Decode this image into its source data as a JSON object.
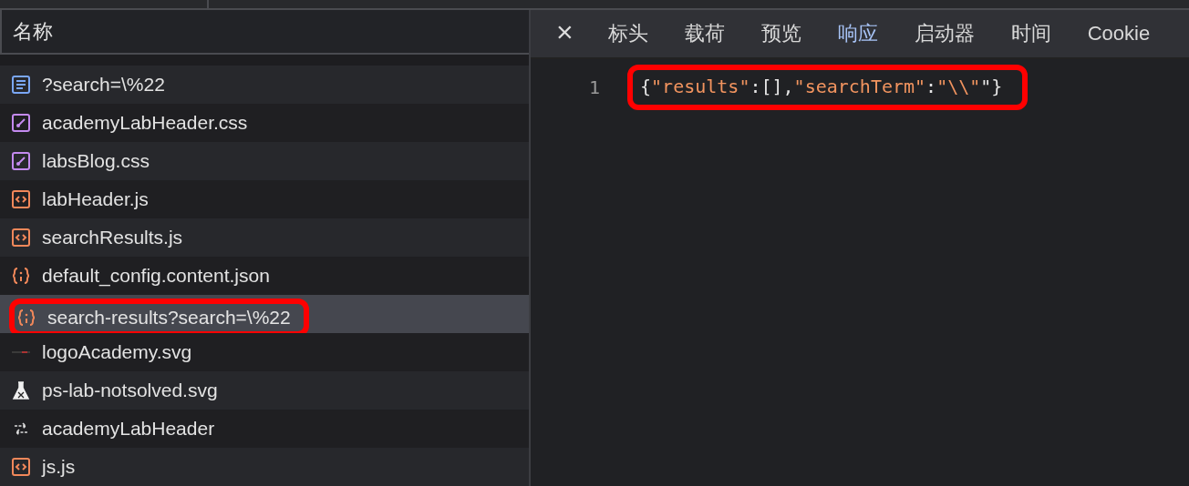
{
  "requests": {
    "column_header": "名称",
    "rows": [
      {
        "name": "?search=\\%22",
        "kind": "document",
        "selected": false,
        "highlighted": false
      },
      {
        "name": "academyLabHeader.css",
        "kind": "stylesheet",
        "selected": false,
        "highlighted": false
      },
      {
        "name": "labsBlog.css",
        "kind": "stylesheet",
        "selected": false,
        "highlighted": false
      },
      {
        "name": "labHeader.js",
        "kind": "script",
        "selected": false,
        "highlighted": false
      },
      {
        "name": "searchResults.js",
        "kind": "script",
        "selected": false,
        "highlighted": false
      },
      {
        "name": "default_config.content.json",
        "kind": "json",
        "selected": false,
        "highlighted": false
      },
      {
        "name": "search-results?search=\\%22",
        "kind": "json",
        "selected": true,
        "highlighted": true
      },
      {
        "name": "logoAcademy.svg",
        "kind": "image",
        "selected": false,
        "highlighted": false
      },
      {
        "name": "ps-lab-notsolved.svg",
        "kind": "flask",
        "selected": false,
        "highlighted": false
      },
      {
        "name": "academyLabHeader",
        "kind": "fetch",
        "selected": false,
        "highlighted": false
      },
      {
        "name": "js.js",
        "kind": "script",
        "selected": false,
        "highlighted": false
      }
    ]
  },
  "detail": {
    "close": "×",
    "tabs": [
      {
        "label": "标头",
        "selected": false
      },
      {
        "label": "载荷",
        "selected": false
      },
      {
        "label": "预览",
        "selected": false
      },
      {
        "label": "响应",
        "selected": true
      },
      {
        "label": "启动器",
        "selected": false
      },
      {
        "label": "时间",
        "selected": false
      },
      {
        "label": "Cookie",
        "selected": false
      }
    ],
    "lines": [
      {
        "number": "1",
        "tokens": [
          {
            "text": "{",
            "kind": "punct"
          },
          {
            "text": "\"results\"",
            "kind": "key"
          },
          {
            "text": ":[],",
            "kind": "punct"
          },
          {
            "text": "\"searchTerm\"",
            "kind": "key"
          },
          {
            "text": ":",
            "kind": "punct"
          },
          {
            "text": "\"\\\\\"",
            "kind": "key"
          },
          {
            "text": "\"}",
            "kind": "punct"
          }
        ],
        "highlighted": true
      }
    ]
  }
}
